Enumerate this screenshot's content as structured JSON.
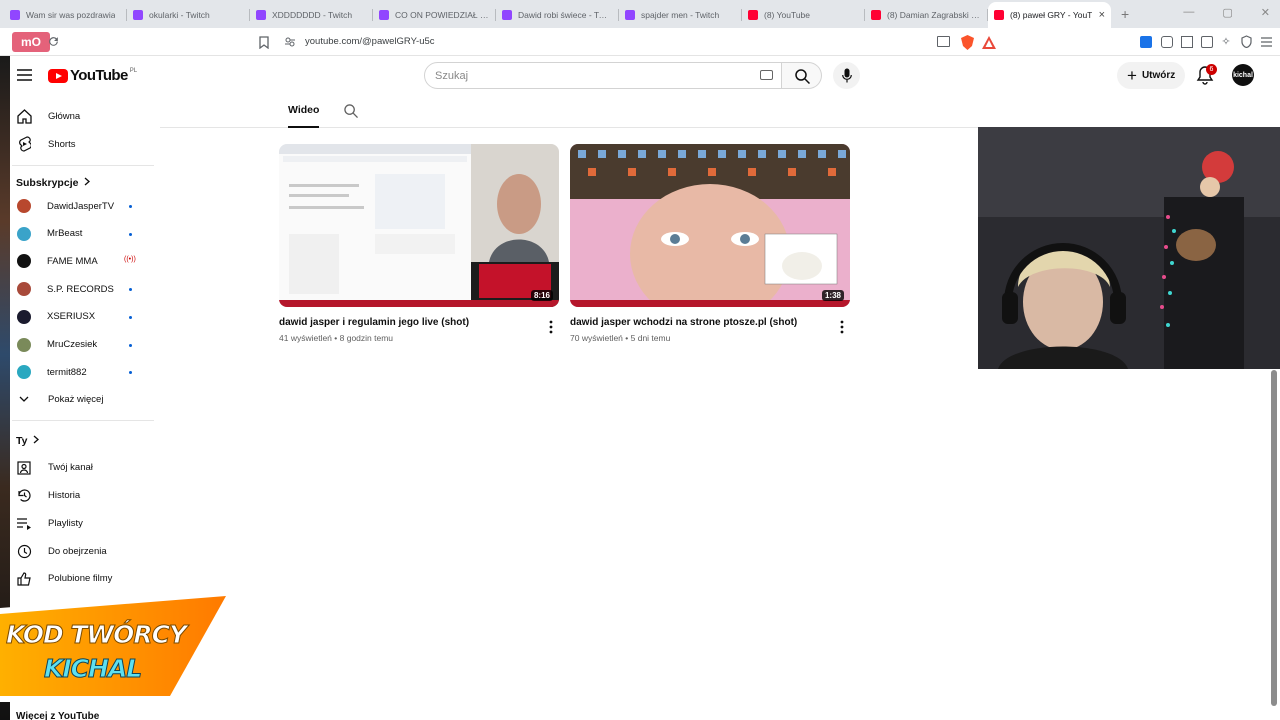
{
  "tabs": [
    {
      "title": "Wam sir was pozdrawia",
      "kind": "twitch"
    },
    {
      "title": "okularki - Twitch",
      "kind": "twitch"
    },
    {
      "title": "XDDDDDDD - Twitch",
      "kind": "twitch"
    },
    {
      "title": "CO ON POWIEDZIAŁ XDD",
      "kind": "twitch"
    },
    {
      "title": "Dawid robi świece - Twitch",
      "kind": "twitch"
    },
    {
      "title": "spajder men - Twitch",
      "kind": "twitch"
    },
    {
      "title": "(8) YouTube",
      "kind": "youtube"
    },
    {
      "title": "(8) Damian Zagrabski - Yo",
      "kind": "youtube"
    },
    {
      "title": "(8) paweł GRY - YouT",
      "kind": "youtube",
      "active": true
    }
  ],
  "browser": {
    "url": "youtube.com/@pawelGRY-u5c",
    "close_glyph": "×",
    "new_tab_glyph": "+"
  },
  "header": {
    "logo_text": "YouTube",
    "logo_country": "PL",
    "search_placeholder": "Szukaj",
    "create_label": "Utwórz",
    "create_plus": "+",
    "notif_count": "6",
    "avatar_text": "kichal"
  },
  "sidebar": {
    "main": [
      {
        "label": "Główna",
        "icon": "home-icon"
      },
      {
        "label": "Shorts",
        "icon": "shorts-icon"
      }
    ],
    "subs_title": "Subskrypcje",
    "subscriptions": [
      {
        "label": "DawidJasperTV",
        "color": "#b8482e",
        "indicator": "dot"
      },
      {
        "label": "MrBeast",
        "color": "#3aa3c9",
        "indicator": "dot"
      },
      {
        "label": "FAME MMA",
        "color": "#111111",
        "indicator": "live"
      },
      {
        "label": "S.P. RECORDS",
        "color": "#a84a3a",
        "indicator": "dot"
      },
      {
        "label": "XSERIUSX",
        "color": "#1b1b2e",
        "indicator": "dot"
      },
      {
        "label": "MruCzesiek",
        "color": "#7a8a5a",
        "indicator": "dot"
      },
      {
        "label": "termit882",
        "color": "#2aa8c0",
        "indicator": "dot"
      }
    ],
    "show_more": "Pokaż więcej",
    "you_title": "Ty",
    "you_items": [
      {
        "label": "Twój kanał",
        "icon": "channel-icon"
      },
      {
        "label": "Historia",
        "icon": "history-icon"
      },
      {
        "label": "Playlisty",
        "icon": "playlist-icon"
      },
      {
        "label": "Do obejrzenia",
        "icon": "watch-later-icon"
      },
      {
        "label": "Polubione filmy",
        "icon": "like-icon"
      }
    ],
    "more_from": "Więcej z YouTube"
  },
  "content": {
    "tab_video": "Wideo",
    "videos": [
      {
        "title": "dawid jasper i regulamin jego live (shot)",
        "views": "41 wyświetleń",
        "age": "8 godzin temu",
        "duration": "8:16"
      },
      {
        "title": "dawid jasper wchodzi na strone ptosze.pl (shot)",
        "views": "70 wyświetleń",
        "age": "5 dni temu",
        "duration": "1:38"
      }
    ]
  },
  "overlay": {
    "line1": "KOD TWÓRCY",
    "line2": "KICHAL"
  }
}
